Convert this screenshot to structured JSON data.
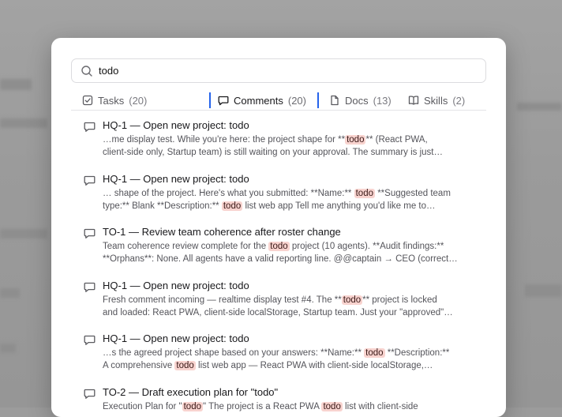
{
  "search": {
    "value": "todo",
    "placeholder": ""
  },
  "tabs": [
    {
      "label": "Tasks",
      "count": "(20)",
      "icon": "checkbox-icon",
      "active": false
    },
    {
      "label": "Comments",
      "count": "(20)",
      "icon": "comment-icon",
      "active": true
    },
    {
      "label": "Docs",
      "count": "(13)",
      "icon": "document-icon",
      "active": false
    },
    {
      "label": "Skills",
      "count": "(2)",
      "icon": "book-icon",
      "active": false
    }
  ],
  "results": [
    {
      "title": "HQ-1 — Open new project: todo",
      "line1": [
        "…me display test. While you're here: the project shape for **",
        "todo",
        "** (React PWA,"
      ],
      "line2": [
        "client-side only, Startup team) is still waiting on your approval. The summary is just…"
      ]
    },
    {
      "title": "HQ-1 — Open new project: todo",
      "line1": [
        "… shape of the project. Here's what you submitted: **Name:** ",
        "todo",
        " **Suggested team"
      ],
      "line2": [
        "type:** Blank **Description:** ",
        "todo",
        " list web app Tell me anything you'd like me to…"
      ]
    },
    {
      "title": "TO-1 — Review team coherence after roster change",
      "line1": [
        "Team coherence review complete for the ",
        "todo",
        " project (10 agents). **Audit findings:**"
      ],
      "line2": [
        "**Orphans**: None. All agents have a valid reporting line. @@captain → CEO (correct…"
      ]
    },
    {
      "title": "HQ-1 — Open new project: todo",
      "line1": [
        "Fresh comment incoming — realtime display test #4. The **",
        "todo",
        "** project is locked"
      ],
      "line2": [
        "and loaded: React PWA, client-side localStorage, Startup team. Just your \"approved\"…"
      ]
    },
    {
      "title": "HQ-1 — Open new project: todo",
      "line1": [
        "…s the agreed project shape based on your answers: **Name:** ",
        "todo",
        " **Description:**"
      ],
      "line2": [
        "A comprehensive ",
        "todo",
        " list web app — React PWA with client-side localStorage,…"
      ]
    },
    {
      "title": "TO-2 — Draft execution plan for \"todo\"",
      "line1": [
        "Execution Plan for \"",
        "todo",
        "\" The project is a React PWA ",
        "todo",
        " list with client-side"
      ],
      "line2": [
        ""
      ]
    }
  ]
}
